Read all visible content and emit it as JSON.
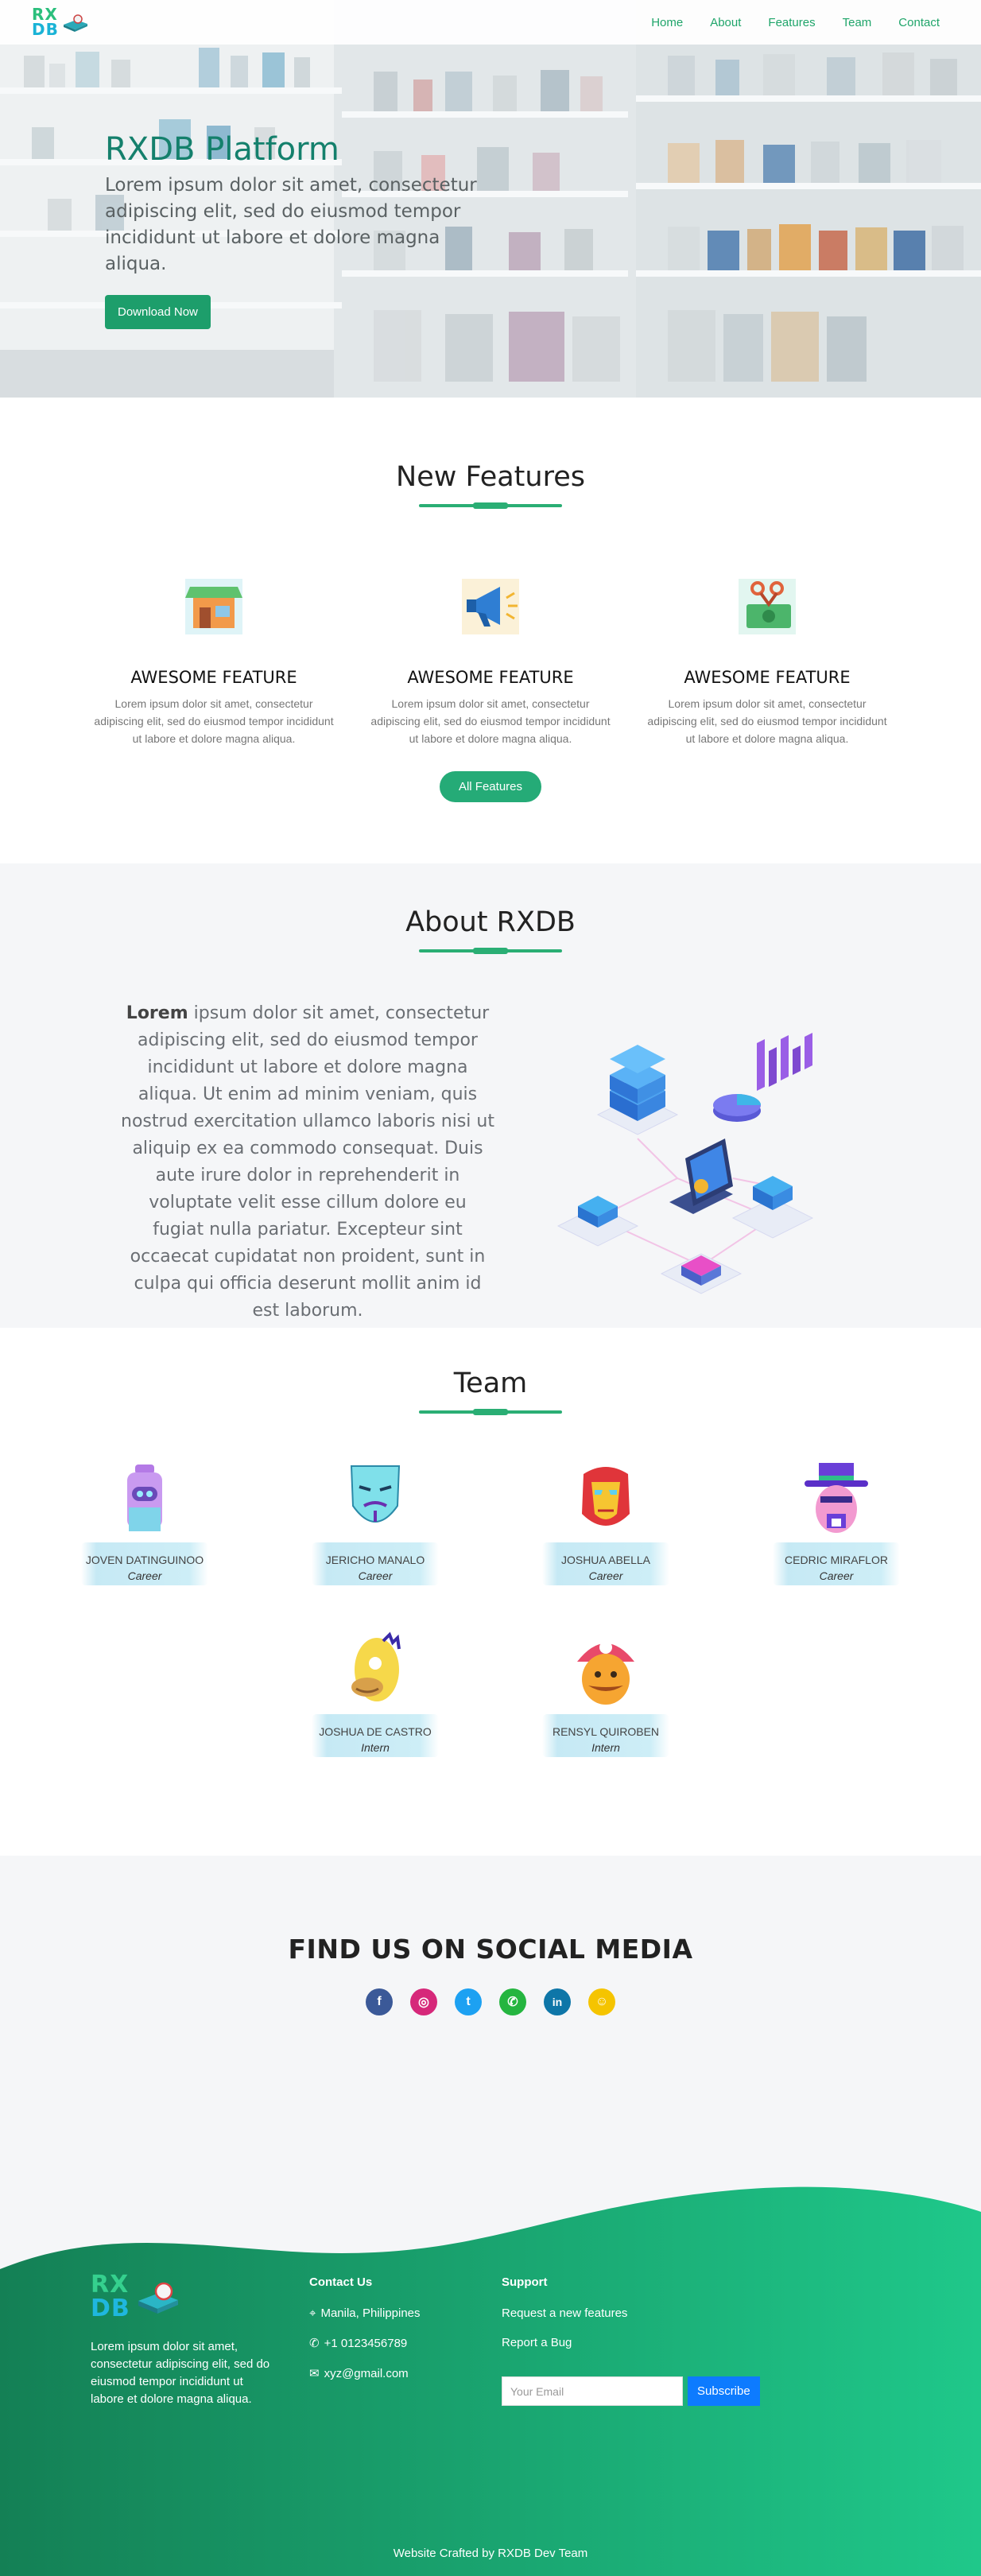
{
  "nav": {
    "logo_line1": "RX",
    "logo_line2": "DB",
    "links": [
      "Home",
      "About",
      "Features",
      "Team",
      "Contact"
    ]
  },
  "hero": {
    "title": "RXDB Platform",
    "subtitle": "Lorem ipsum dolor sit amet, consectetur adipiscing elit, sed do eiusmod tempor incididunt ut labore et dolore magna aliqua.",
    "button": "Download Now"
  },
  "features": {
    "title": "New Features",
    "items": [
      {
        "icon": "store-icon",
        "title": "AWESOME FEATURE",
        "desc": "Lorem ipsum dolor sit amet, consectetur adipiscing elit, sed do eiusmod tempor incididunt ut labore et dolore magna aliqua."
      },
      {
        "icon": "megaphone-icon",
        "title": "AWESOME FEATURE",
        "desc": "Lorem ipsum dolor sit amet, consectetur adipiscing elit, sed do eiusmod tempor incididunt ut labore et dolore magna aliqua."
      },
      {
        "icon": "money-icon",
        "title": "AWESOME FEATURE",
        "desc": "Lorem ipsum dolor sit amet, consectetur adipiscing elit, sed do eiusmod tempor incididunt ut labore et dolore magna aliqua."
      }
    ],
    "button": "All Features"
  },
  "about": {
    "title": "About RXDB",
    "lead": "Lorem",
    "text": " ipsum dolor sit amet, consectetur adipiscing elit, sed do eiusmod tempor incididunt ut labore et dolore magna aliqua. Ut enim ad minim veniam, quis nostrud exercitation ullamco laboris nisi ut aliquip ex ea commodo consequat. Duis aute irure dolor in reprehenderit in voluptate velit esse cillum dolore eu fugiat nulla pariatur. Excepteur sint occaecat cupidatat non proident, sunt in culpa qui officia deserunt mollit anim id est laborum."
  },
  "team": {
    "title": "Team",
    "members": [
      {
        "name": "JOVEN DATINGUINOO",
        "role": "Career",
        "avatar": "robot-icon"
      },
      {
        "name": "JERICHO MANALO",
        "role": "Career",
        "avatar": "mask-icon"
      },
      {
        "name": "JOSHUA ABELLA",
        "role": "Career",
        "avatar": "ironman-icon"
      },
      {
        "name": "CEDRIC MIRAFLOR",
        "role": "Career",
        "avatar": "heisenberg-icon"
      },
      {
        "name": "JOSHUA DE CASTRO",
        "role": "Intern",
        "avatar": "homer-icon"
      },
      {
        "name": "RENSYL QUIROBEN",
        "role": "Intern",
        "avatar": "mario-icon"
      }
    ]
  },
  "social": {
    "title": "FIND US ON SOCIAL MEDIA",
    "icons": [
      {
        "name": "facebook-icon",
        "glyph": "f",
        "color": "#3b5998"
      },
      {
        "name": "instagram-icon",
        "glyph": "◎",
        "color": "#d6287a"
      },
      {
        "name": "twitter-icon",
        "glyph": "t",
        "color": "#1da1f2"
      },
      {
        "name": "whatsapp-icon",
        "glyph": "✆",
        "color": "#25b540"
      },
      {
        "name": "linkedin-icon",
        "glyph": "in",
        "color": "#0e76a8"
      },
      {
        "name": "snapchat-icon",
        "glyph": "☺",
        "color": "#f5c400"
      }
    ]
  },
  "footer": {
    "logo_line1": "RX",
    "logo_line2": "DB",
    "about": "Lorem ipsum dolor sit amet, consectetur adipiscing elit, sed do eiusmod tempor incididunt ut labore et dolore magna aliqua.",
    "contact_title": "Contact Us",
    "location": "Manila, Philippines",
    "phone": "+1 0123456789",
    "email": "xyz@gmail.com",
    "support_title": "Support",
    "support_links": [
      "Request a new features",
      "Report a Bug"
    ],
    "subscribe_placeholder": "Your Email",
    "subscribe_button": "Subscribe",
    "credit": "Website Crafted by RXDB Dev Team"
  },
  "colors": {
    "brand_green": "#1d9e6b",
    "brand_cyan": "#1ab3d6",
    "footer_start": "#148055",
    "footer_end": "#1fc88a"
  }
}
